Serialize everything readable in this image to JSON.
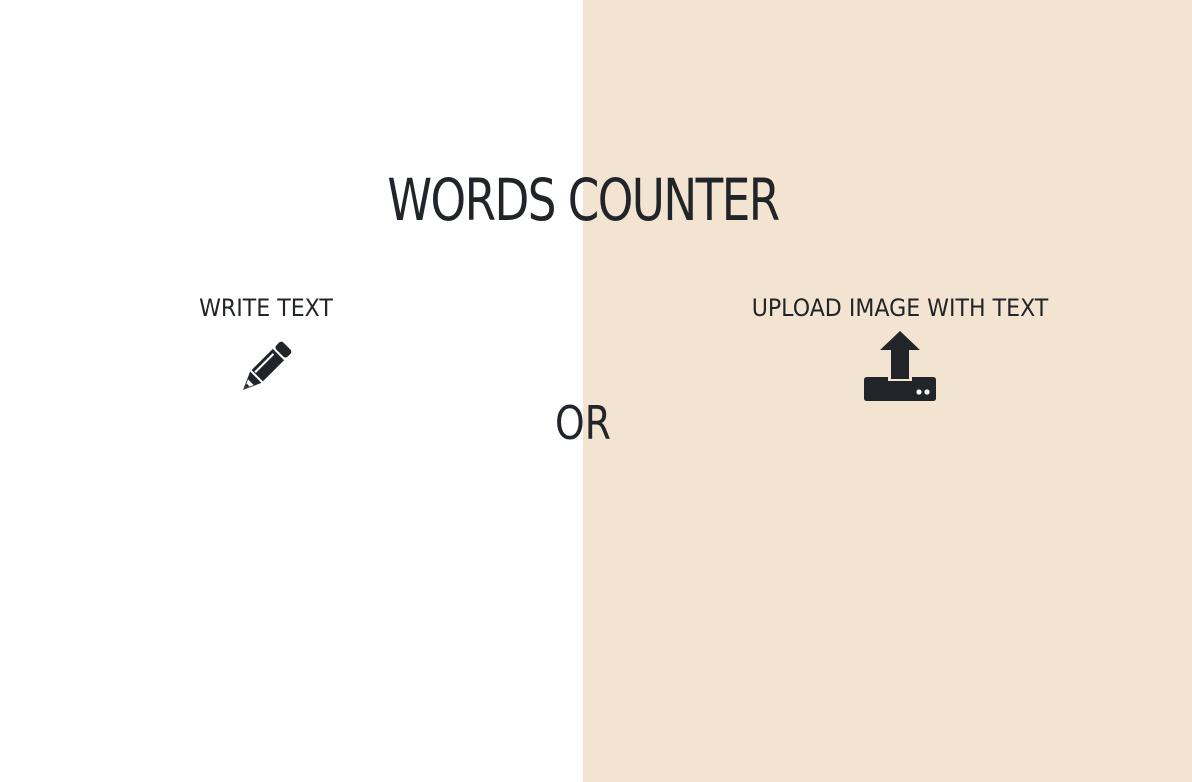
{
  "page": {
    "title": "WORDS COUNTER",
    "separator": "OR"
  },
  "colors": {
    "text": "#212529",
    "left_background": "#ffffff",
    "right_background": "#f2e4d1"
  },
  "options": [
    {
      "label": "WRITE TEXT",
      "icon": "pencil-icon"
    },
    {
      "label": "UPLOAD IMAGE WITH TEXT",
      "icon": "upload-icon"
    }
  ]
}
